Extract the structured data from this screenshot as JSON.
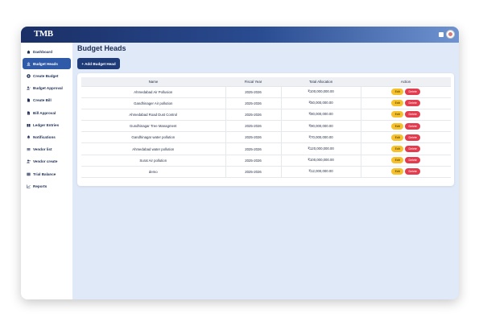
{
  "app": {
    "logo": "TMB"
  },
  "sidebar": {
    "items": [
      {
        "label": "Dashboard",
        "icon": "home-icon",
        "active": false
      },
      {
        "label": "Budget Heads",
        "icon": "bank-icon",
        "active": true
      },
      {
        "label": "Create Budget",
        "icon": "plus-circle-icon",
        "active": false
      },
      {
        "label": "Budget Approval",
        "icon": "user-check-icon",
        "active": false
      },
      {
        "label": "Create Bill",
        "icon": "file-icon",
        "active": false
      },
      {
        "label": "Bill Approval",
        "icon": "check-file-icon",
        "active": false
      },
      {
        "label": "Ledger Entries",
        "icon": "book-icon",
        "active": false
      },
      {
        "label": "Notifications",
        "icon": "bell-icon",
        "active": false
      },
      {
        "label": "Vendor list",
        "icon": "list-icon",
        "active": false
      },
      {
        "label": "Vendor create",
        "icon": "user-plus-icon",
        "active": false
      },
      {
        "label": "Trial Balance",
        "icon": "scale-icon",
        "active": false
      },
      {
        "label": "Reports",
        "icon": "chart-icon",
        "active": false
      }
    ]
  },
  "main": {
    "title": "Budget Heads",
    "add_button": "+ Add Budget Head",
    "table": {
      "headers": [
        "Name",
        "Fiscal Year",
        "Total Allocation",
        "Action"
      ],
      "rows": [
        {
          "name": "Ahmedabad Air Pollusion",
          "year": "2025-2026",
          "allocation": "₹100,000,000.00"
        },
        {
          "name": "Gandhinager Air pollution",
          "year": "2025-2026",
          "allocation": "₹50,000,000.00"
        },
        {
          "name": "Ahmedabad Road Dust Control",
          "year": "2025-2026",
          "allocation": "₹80,000,000.00"
        },
        {
          "name": "Gundhinagar Tree Managment",
          "year": "2025-2026",
          "allocation": "₹90,000,000.00"
        },
        {
          "name": "Gandhinagar water pollution",
          "year": "2025-2026",
          "allocation": "₹70,000,000.00"
        },
        {
          "name": "Ahmedabad water pollution",
          "year": "2025-2026",
          "allocation": "₹120,000,000.00"
        },
        {
          "name": "Surat Air pollution",
          "year": "2025-2026",
          "allocation": "₹100,000,000.00"
        },
        {
          "name": "demo",
          "year": "2025-2026",
          "allocation": "₹12,000,000.00"
        }
      ],
      "edit_label": "Edit",
      "delete_label": "Delete"
    }
  },
  "colors": {
    "accent": "#2f5aa8",
    "edit": "#f6c12b",
    "delete": "#e23c4e"
  }
}
